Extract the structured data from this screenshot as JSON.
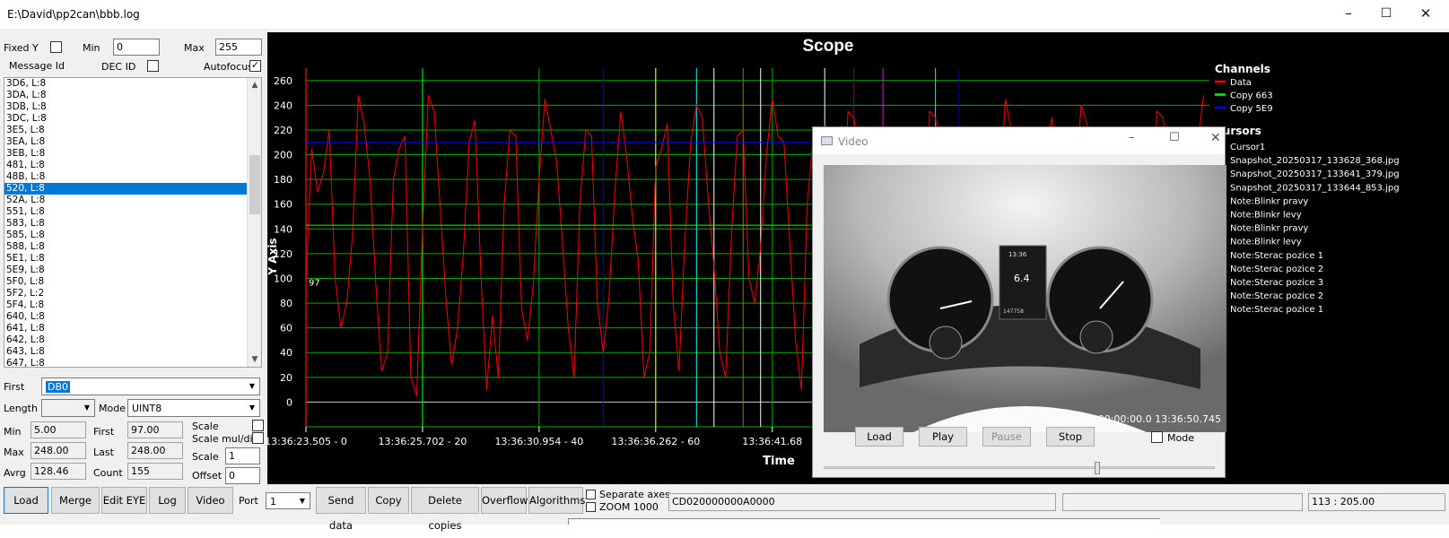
{
  "window": {
    "title": "E:\\David\\pp2can\\bbb.log",
    "min": "–",
    "max": "☐",
    "close": "✕"
  },
  "controls": {
    "fixed_y": "Fixed Y",
    "min_label": "Min",
    "min_value": "0",
    "max_label": "Max",
    "max_value": "255",
    "message_id": "Message Id",
    "dec_id": "DEC ID",
    "autofocus": "Autofocus",
    "autofocus_checked": true
  },
  "messages": [
    "3D6, L:8",
    "3DA, L:8",
    "3DB, L:8",
    "3DC, L:8",
    "3E5, L:8",
    "3EA, L:8",
    "3EB, L:8",
    "481, L:8",
    "48B, L:8",
    "520, L:8",
    "52A, L:8",
    "551, L:8",
    "583, L:8",
    "585, L:8",
    "588, L:8",
    "5E1, L:8",
    "5E9, L:8",
    "5F0, L:8",
    "5F2, L:2",
    "5F4, L:8",
    "640, L:8",
    "641, L:8",
    "642, L:8",
    "643, L:8",
    "647, L:8"
  ],
  "selected_message": "520, L:8",
  "fields": {
    "first_label": "First",
    "first_value": "DB0",
    "length_label": "Length",
    "length_value": "",
    "mode_label": "Mode",
    "mode_value": "UINT8",
    "min_label": "Min",
    "min_value": "5.00",
    "first2_label": "First",
    "first2_value": "97.00",
    "scale_label": "Scale",
    "max_label": "Max",
    "max_value": "248.00",
    "last_label": "Last",
    "last_value": "248.00",
    "scale_mul": "Scale mul/div",
    "avrg_label": "Avrg",
    "avrg_value": "128.46",
    "count_label": "Count",
    "count_value": "155",
    "scale2_label": "Scale",
    "scale2_value": "1",
    "offset_label": "Offset",
    "offset_value": "0"
  },
  "toolbar": {
    "load": "Load",
    "merge": "Merge",
    "edit_eye": "Edit EYE",
    "log": "Log",
    "video": "Video",
    "port_label": "Port",
    "port_value": "1",
    "send_data": "Send data",
    "copy": "Copy",
    "delete_copies": "Delete copies",
    "overflow": "Overflow",
    "algorithms": "Algorithms",
    "separate_axes": "Separate axes",
    "zoom": "ZOOM 1000",
    "data_field": "CD020000000A0000",
    "status_field": "",
    "coords": "113 : 205.00"
  },
  "chart_data": {
    "type": "line",
    "title": "Scope",
    "xlabel": "Time",
    "ylabel": "Y Axis",
    "ylim": [
      -20,
      270
    ],
    "yticks": [
      0,
      20,
      40,
      60,
      80,
      100,
      120,
      140,
      160,
      180,
      200,
      220,
      240,
      260
    ],
    "xtick_labels": [
      "13:36:23.505 - 0",
      "13:36:25.702 - 20",
      "13:36:30.954 - 40",
      "13:36:36.262 - 60",
      "13:36:41.68"
    ],
    "xlim": [
      0,
      155
    ],
    "point_label": "97",
    "grid": true,
    "legend_placement": "right",
    "channels_title": "Channels",
    "cursors_title": "Cursors",
    "channels": [
      {
        "name": "Data",
        "color": "#ff0000"
      },
      {
        "name": "Copy 663",
        "color": "#00ff00"
      },
      {
        "name": "Copy 5E9",
        "color": "#0000ff"
      }
    ],
    "cursors": [
      {
        "name": "Cursor1",
        "color": "#ff0000"
      },
      {
        "name": "Snapshot_20250317_133628_368.jpg",
        "color": "#00ff00"
      },
      {
        "name": "Snapshot_20250317_133641_379.jpg",
        "color": "#0000ff"
      },
      {
        "name": "Snapshot_20250317_133644_853.jpg",
        "color": "#ffff00"
      },
      {
        "name": "Note:Blinkr pravy",
        "color": "#00ffff"
      },
      {
        "name": "Note:Blinkr levy",
        "color": "#ffffff"
      },
      {
        "name": "Note:Blinkr pravy",
        "color": "#808000"
      },
      {
        "name": "Note:Blinkr levy",
        "color": "#ffffff"
      },
      {
        "name": "Note:Sterac pozice 1",
        "color": "#c0c0c0"
      },
      {
        "name": "Note:Sterac pozice 2",
        "color": "#800080"
      },
      {
        "name": "Note:Sterac pozice 3",
        "color": "#ff00ff"
      },
      {
        "name": "Note:Sterac pozice 2",
        "color": "#008080"
      },
      {
        "name": "Note:Sterac pozice 1",
        "color": "#000080"
      }
    ],
    "vertical_cursors": [
      {
        "x": 0,
        "color": "#ff0000"
      },
      {
        "x": 20,
        "color": "#00ff00"
      },
      {
        "x": 51,
        "color": "#0000ff"
      },
      {
        "x": 60,
        "color": "#ffff00"
      },
      {
        "x": 67,
        "color": "#00ffff"
      },
      {
        "x": 70,
        "color": "#ffffff"
      },
      {
        "x": 75,
        "color": "#808000"
      },
      {
        "x": 78,
        "color": "#ffffff"
      },
      {
        "x": 89,
        "color": "#ffffff"
      },
      {
        "x": 94,
        "color": "#800080"
      },
      {
        "x": 99,
        "color": "#ff00ff"
      },
      {
        "x": 108,
        "color": "#00ffff"
      },
      {
        "x": 112,
        "color": "#000080"
      }
    ],
    "series": [
      {
        "name": "Data",
        "color": "#ff0000",
        "values": [
          97,
          205,
          170,
          185,
          220,
          100,
          60,
          80,
          135,
          248,
          225,
          180,
          95,
          25,
          40,
          180,
          205,
          215,
          20,
          5,
          140,
          248,
          235,
          160,
          85,
          30,
          60,
          120,
          210,
          228,
          105,
          10,
          70,
          20,
          160,
          220,
          215,
          75,
          50,
          95,
          180,
          245,
          220,
          195,
          130,
          60,
          20,
          160,
          220,
          215,
          80,
          40,
          85,
          170,
          235,
          200,
          150,
          115,
          20,
          40,
          190,
          205,
          225,
          80,
          25,
          130,
          210,
          240,
          230,
          165,
          110,
          40,
          20,
          135,
          215,
          220,
          100,
          80,
          125,
          200,
          245,
          215,
          210,
          130,
          50,
          10,
          160,
          215,
          220,
          90,
          40,
          80,
          135,
          235,
          230,
          195,
          100,
          45,
          20,
          140,
          205,
          215,
          190,
          120,
          40,
          80,
          145,
          235,
          230,
          195,
          100,
          40,
          25,
          135,
          205,
          220,
          120,
          40,
          85,
          170,
          245,
          220,
          200,
          100,
          40,
          30,
          160,
          210,
          230,
          95,
          60,
          90,
          175,
          240,
          225,
          150,
          100,
          40,
          20,
          160,
          220,
          220,
          90,
          40,
          70,
          140,
          235,
          230,
          200,
          130,
          40,
          20,
          150,
          210,
          248
        ]
      },
      {
        "name": "Copy 663",
        "color": "#00ff00",
        "values": [
          143,
          143,
          143,
          143,
          143,
          143,
          143,
          143,
          143,
          143,
          143,
          143,
          143,
          143,
          143,
          143,
          143,
          143,
          143,
          143,
          143,
          143,
          143,
          143,
          143,
          143,
          143,
          143,
          143,
          143,
          143,
          143,
          143,
          143,
          143,
          143,
          143,
          143,
          143,
          143,
          143,
          143,
          143,
          143,
          143,
          143,
          143,
          143,
          143,
          143,
          143,
          143,
          143,
          143,
          143,
          143,
          143,
          143,
          143,
          143,
          143,
          143,
          143,
          143,
          143,
          143,
          143,
          143,
          143,
          143,
          143,
          143,
          143,
          143,
          143,
          143,
          143,
          143,
          143,
          143,
          143,
          143,
          143,
          143,
          143,
          143,
          143,
          143,
          143,
          143,
          143,
          143,
          143,
          143,
          143,
          143,
          143,
          143,
          143,
          143,
          143,
          143,
          143,
          143,
          143,
          143,
          143,
          143,
          143,
          143,
          143,
          143,
          143,
          143,
          143,
          143,
          143,
          143,
          143,
          143,
          143,
          143,
          143,
          143,
          143,
          143,
          143,
          143,
          143,
          143,
          143,
          143,
          143,
          143,
          143,
          143,
          143,
          143,
          143,
          143,
          143,
          143,
          143,
          143,
          143,
          143,
          143,
          143,
          143,
          143,
          143,
          143,
          143,
          143,
          143
        ]
      },
      {
        "name": "Copy 5E9",
        "color": "#0000ff",
        "values": [
          210,
          210,
          210,
          210,
          210,
          210,
          210,
          210,
          210,
          210,
          210,
          210,
          210,
          210,
          210,
          210,
          210,
          210,
          210,
          210,
          210,
          210,
          210,
          210,
          210,
          210,
          210,
          210,
          210,
          210,
          210,
          210,
          210,
          210,
          210,
          210,
          210,
          210,
          210,
          210,
          210,
          210,
          210,
          210,
          210,
          210,
          210,
          210,
          210,
          210,
          210,
          210,
          210,
          210,
          210,
          210,
          210,
          210,
          210,
          210,
          210,
          210,
          210,
          210,
          210,
          210,
          210,
          210,
          210,
          210,
          210,
          210,
          210,
          210,
          210,
          210,
          210,
          210,
          210,
          210,
          210,
          210,
          210,
          210,
          210,
          210,
          210,
          210,
          210,
          210,
          210,
          210,
          210,
          210,
          210,
          210,
          210,
          210,
          210,
          210,
          210,
          210,
          210,
          210,
          210,
          210,
          210,
          210,
          210,
          210,
          210,
          210,
          210,
          210,
          210,
          210,
          210,
          210,
          210,
          210,
          210,
          210,
          210,
          210,
          210,
          210,
          210,
          210,
          210,
          210,
          210,
          210,
          210,
          210,
          210,
          210,
          210,
          210,
          210,
          210,
          210,
          210,
          210,
          210,
          210,
          210,
          210,
          210,
          210,
          210,
          210,
          210,
          210,
          210,
          210
        ]
      }
    ]
  },
  "video": {
    "title": "Video",
    "load": "Load",
    "play": "Play",
    "pause": "Pause",
    "stop": "Stop",
    "mode": "Mode",
    "timestamp": "00:00:00.0 13:36:50.745",
    "slider_position": 0.7,
    "dash_display": [
      "13:36",
      "6.4",
      "147758"
    ]
  }
}
